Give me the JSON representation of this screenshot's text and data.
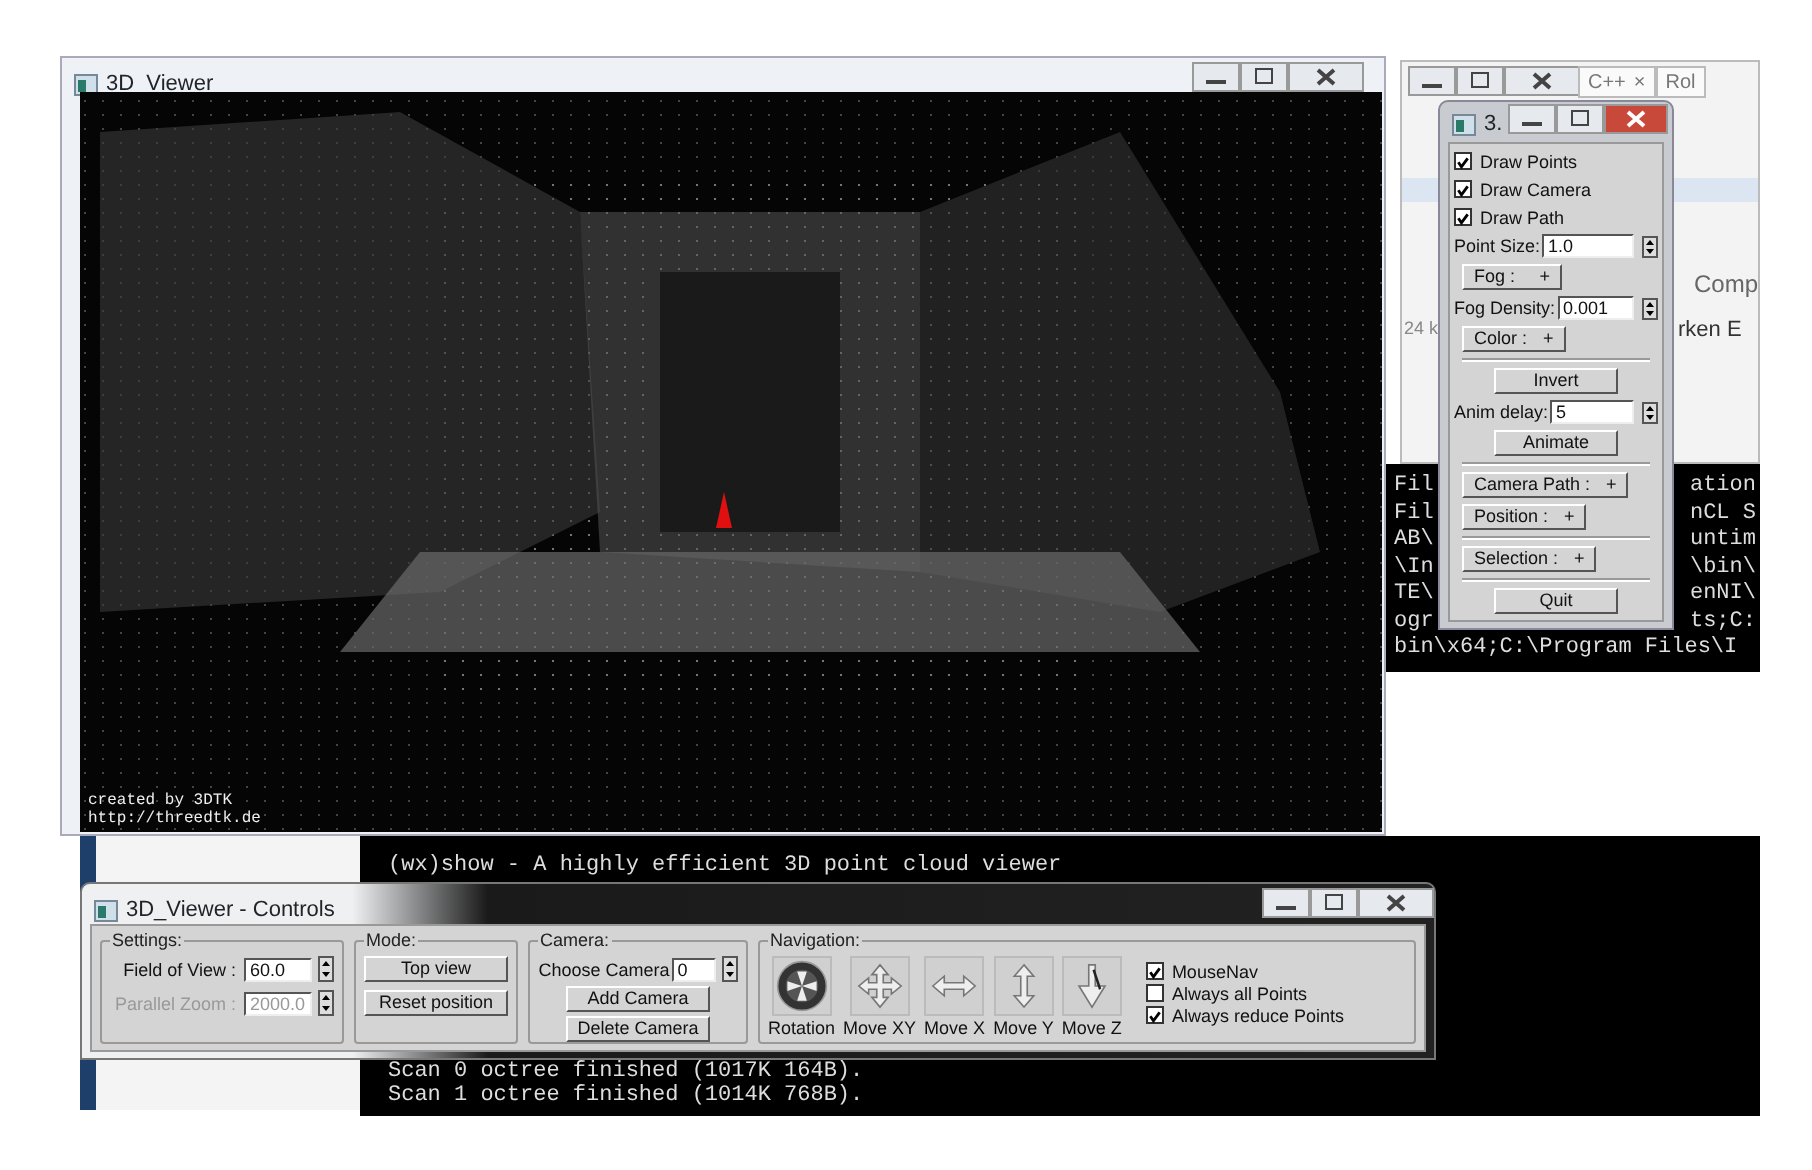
{
  "viewer_window": {
    "title": "3D_Viewer",
    "caption_lines": [
      "created by 3DTK",
      "http://threedtk.de"
    ]
  },
  "background_window": {
    "tabs": [
      {
        "label": "C++",
        "close": "×"
      },
      {
        "label": "Rol"
      }
    ],
    "texts": [
      "Comp",
      "24 k",
      "rken E"
    ]
  },
  "console_right": {
    "lines": [
      {
        "left": "Fil",
        "right": "ation"
      },
      {
        "left": "Fil",
        "right": "nCL S"
      },
      {
        "left": "AB\\",
        "right": "untim"
      },
      {
        "left": "\\In",
        "right": "\\bin\\"
      },
      {
        "left": "TE\\",
        "right": "enNI\\"
      },
      {
        "left": "ogr",
        "right": "ts;C:"
      }
    ],
    "full_line": "bin\\x64;C:\\Program Files\\I"
  },
  "console_bottom": {
    "lines": [
      "(wx)show - A highly efficient 3D point cloud viewer",
      "Scan 0 octree finished (1017K 164B).",
      "Scan 1 octree finished (1014K 768B)."
    ]
  },
  "settings_window": {
    "title": "3.",
    "items": [
      {
        "kind": "checkbox",
        "label": "Draw Points",
        "checked": true
      },
      {
        "kind": "checkbox",
        "label": "Draw Camera",
        "checked": true
      },
      {
        "kind": "checkbox",
        "label": "Draw Path",
        "checked": true
      },
      {
        "kind": "spin",
        "label": "Point Size:",
        "value": "1.0"
      },
      {
        "kind": "fold",
        "label": "Fog :",
        "sign": "+"
      },
      {
        "kind": "spin",
        "label": "Fog Density:",
        "value": "0.001"
      },
      {
        "kind": "fold",
        "label": "Color :",
        "sign": "+"
      },
      {
        "kind": "rule"
      },
      {
        "kind": "button",
        "label": "Invert"
      },
      {
        "kind": "spin",
        "label": "Anim delay:",
        "value": "5"
      },
      {
        "kind": "button",
        "label": "Animate"
      },
      {
        "kind": "rule"
      },
      {
        "kind": "fold",
        "label": "Camera Path :",
        "sign": "+"
      },
      {
        "kind": "fold",
        "label": "Position :",
        "sign": "+"
      },
      {
        "kind": "rule"
      },
      {
        "kind": "fold",
        "label": "Selection :",
        "sign": "+"
      },
      {
        "kind": "rule"
      },
      {
        "kind": "button",
        "label": "Quit"
      }
    ]
  },
  "controls_window": {
    "title": "3D_Viewer - Controls",
    "settings": {
      "legend": "Settings:",
      "rows": [
        {
          "label": "Field of View :",
          "value": "60.0",
          "disabled": false
        },
        {
          "label": "Parallel Zoom :",
          "value": "2000.0",
          "disabled": true
        }
      ]
    },
    "mode": {
      "legend": "Mode:",
      "buttons": [
        "Top view",
        "Reset position"
      ]
    },
    "camera": {
      "legend": "Camera:",
      "label": "Choose Camera",
      "value": "0",
      "buttons": [
        "Add Camera",
        "Delete Camera"
      ]
    },
    "navigation": {
      "legend": "Navigation:",
      "tools": [
        {
          "kind": "rotate",
          "label": "Rotation"
        },
        {
          "kind": "move_xy",
          "label": "Move XY"
        },
        {
          "kind": "move_x",
          "label": "Move X"
        },
        {
          "kind": "move_y",
          "label": "Move Y"
        },
        {
          "kind": "move_z",
          "label": "Move Z"
        }
      ]
    },
    "options": [
      {
        "label": "MouseNav",
        "checked": true
      },
      {
        "label": "Always all Points",
        "checked": false
      },
      {
        "label": "Always reduce Points",
        "checked": true
      }
    ]
  }
}
